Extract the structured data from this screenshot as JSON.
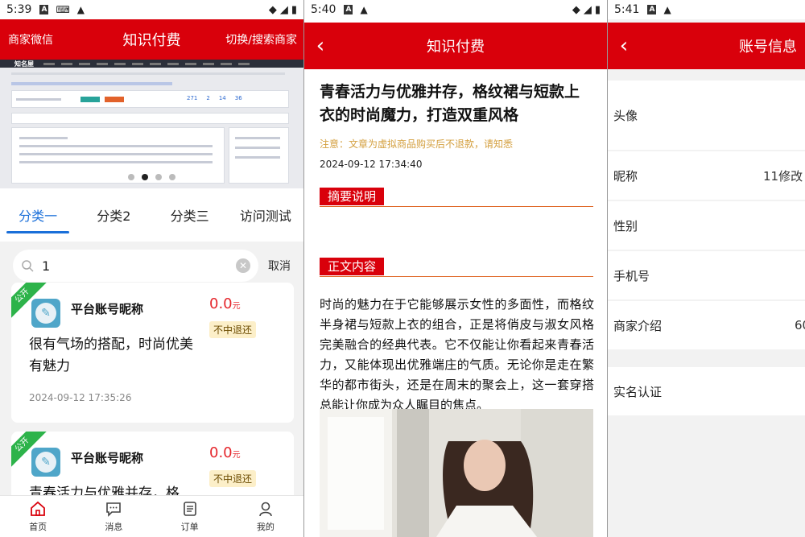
{
  "screen1": {
    "status": {
      "time": "5:39"
    },
    "header": {
      "left": "商家微信",
      "title": "知识付费",
      "right": "切换/搜索商家"
    },
    "banner": {
      "logo": "知名屋",
      "stats": [
        "271",
        "2",
        "14",
        "36"
      ]
    },
    "tabs": [
      "分类一",
      "分类2",
      "分类三",
      "访问测试"
    ],
    "search": {
      "value": "1",
      "cancel": "取消"
    },
    "cards": [
      {
        "ribbon": "公开",
        "nickname": "平台账号昵称",
        "price": "0.0",
        "unit": "元",
        "badge": "不中退还",
        "desc": "很有气场的搭配，时尚优美有魅力",
        "time": "2024-09-12 17:35:26"
      },
      {
        "ribbon": "公开",
        "nickname": "平台账号昵称",
        "price": "0.0",
        "unit": "元",
        "badge": "不中退还",
        "desc": "青春活力与优雅并存，格",
        "time": ""
      }
    ],
    "nav": [
      "首页",
      "消息",
      "订单",
      "我的"
    ]
  },
  "screen2": {
    "status": {
      "time": "5:40"
    },
    "header": {
      "title": "知识付费"
    },
    "title": "青春活力与优雅并存，格纹裙与短款上衣的时尚魔力，打造双重风格",
    "notice": "注意：文章为虚拟商品购买后不退款，请知悉",
    "time": "2024-09-12 17:34:40",
    "summary_label": "摘要说明",
    "content_label": "正文内容",
    "body": "时尚的魅力在于它能够展示女性的多面性，而格纹半身裙与短款上衣的组合，正是将俏皮与淑女风格完美融合的经典代表。它不仅能让你看起来青春活力，又能体现出优雅端庄的气质。无论你是走在繁华的都市街头，还是在周末的聚会上，这一套穿搭总能让你成为众人瞩目的焦点。"
  },
  "screen3": {
    "status": {
      "time": "5:41"
    },
    "header": {
      "title": "账号信息"
    },
    "rows": [
      {
        "label": "头像",
        "value": ""
      },
      {
        "label": "昵称",
        "value": "11修改"
      },
      {
        "label": "性别",
        "value": ""
      },
      {
        "label": "手机号",
        "value": ""
      },
      {
        "label": "商家介绍",
        "value": "60"
      },
      {
        "label": "实名认证",
        "value": ""
      }
    ]
  },
  "colors": {
    "brand_red": "#d9000b",
    "tab_blue": "#1a6fd9",
    "price_red": "#e5262c",
    "ribbon_green": "#2db34a"
  }
}
